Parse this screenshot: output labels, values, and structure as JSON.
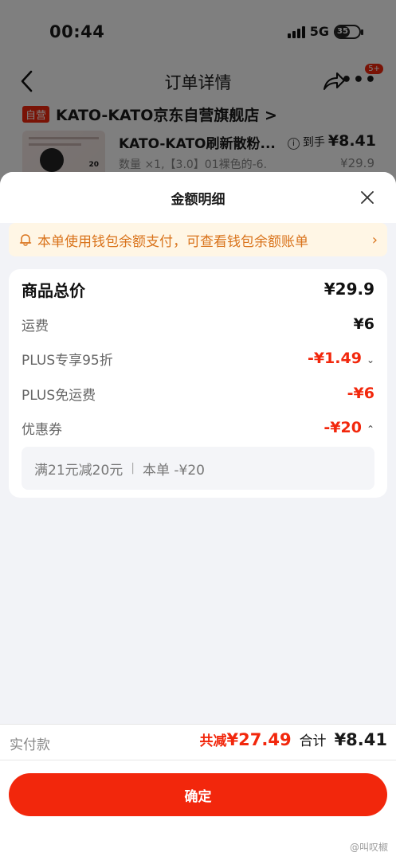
{
  "status_bar": {
    "time": "00:44",
    "network": "5G",
    "battery": "35"
  },
  "nav": {
    "title": "订单详情",
    "more_badge": "5+"
  },
  "store": {
    "tag": "自营",
    "name": "KATO-KATO京东自营旗舰店 >"
  },
  "product": {
    "name": "KATO-KATO刷新散粉...",
    "spec": "数量 ×1,【3.0】01裸色的-6.",
    "price_prefix": "到手",
    "price": "¥8.41",
    "original_price": "¥29.9",
    "thumb_badge": "20"
  },
  "sheet": {
    "title": "金额明细",
    "notice": "本单使用钱包余额支付，可查看钱包余额账单",
    "rows": {
      "total": {
        "label": "商品总价",
        "value": "¥29.9"
      },
      "shipping": {
        "label": "运费",
        "value": "¥6"
      },
      "plus_discount": {
        "label": "PLUS专享95折",
        "value": "-¥1.49"
      },
      "plus_shipping": {
        "label": "PLUS免运费",
        "value": "-¥6"
      },
      "coupon": {
        "label": "优惠券",
        "value": "-¥20"
      }
    },
    "coupon_detail": {
      "rule": "满21元减20元",
      "amount": "本单 -¥20"
    }
  },
  "footer": {
    "paid_label": "实付款",
    "saved_prefix": "共减",
    "saved_amount": "¥27.49",
    "total_label": "合计",
    "total_amount": "¥8.41",
    "confirm": "确定",
    "watermark": "@叫叹椒"
  },
  "colors": {
    "accent": "#f2270c",
    "notice_text": "#d9731b",
    "notice_bg": "#fff6e5"
  }
}
